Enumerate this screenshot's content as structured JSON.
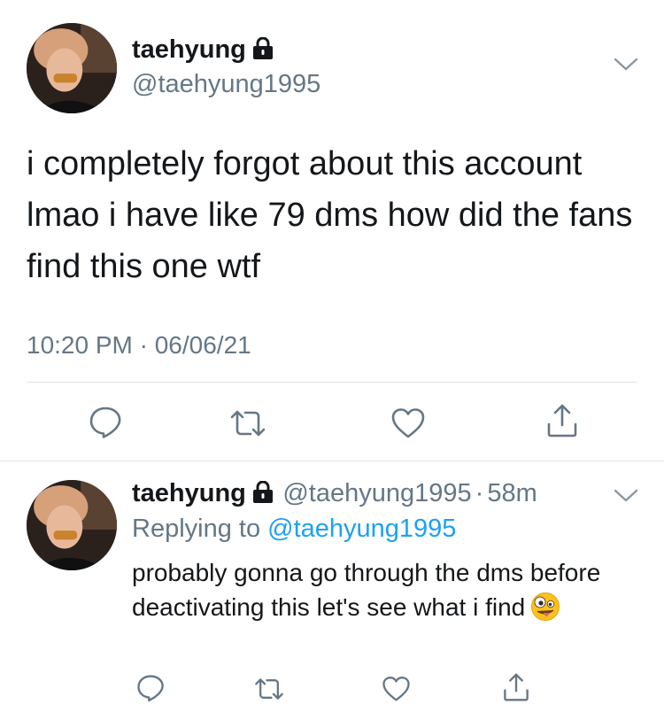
{
  "main_tweet": {
    "display_name": "taehyung",
    "handle": "@taehyung1995",
    "text": "i completely forgot about this account lmao i have like 79 dms how did the fans find this one wtf",
    "timestamp": "10:20 PM · 06/06/21",
    "icons": [
      "lock-icon",
      "chevron-down-icon",
      "reply-icon",
      "retweet-icon",
      "like-icon",
      "share-icon"
    ]
  },
  "reply_tweet": {
    "display_name": "taehyung",
    "handle": "@taehyung1995",
    "separator": "·",
    "age": "58m",
    "replying_prefix": "Replying to",
    "replying_handle": "@taehyung1995",
    "text": "probably gonna go through the dms before deactivating this let's see what i find",
    "emoji": "zany-face-emoji"
  },
  "colors": {
    "text": "#14171a",
    "secondary": "#657786",
    "link": "#1da1f2",
    "divider": "#dfe3e8"
  }
}
